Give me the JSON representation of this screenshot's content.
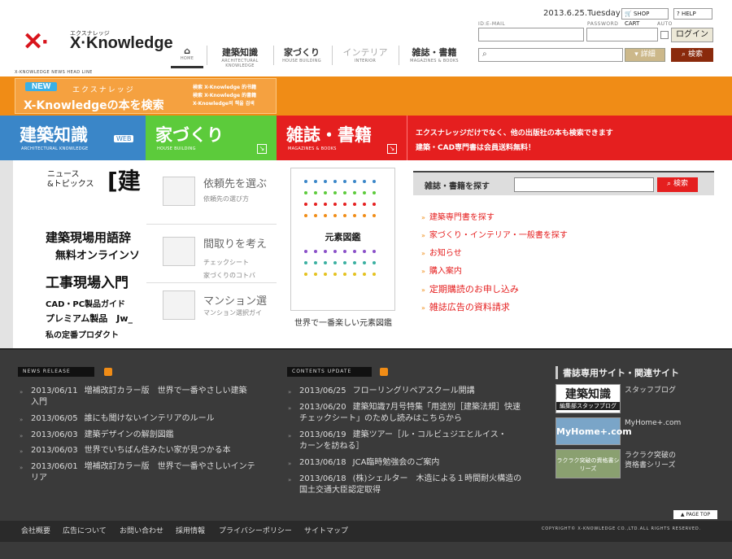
{
  "header": {
    "logo_text": "X·Knowledge",
    "logo_sub": "エクスナレッジ",
    "date": "2013.6.25.Tuesday",
    "shop_cart": "SHOP CART",
    "help": "HELP",
    "id_label": "ID:E-MAIL",
    "password_label": "PASSWORD",
    "auto_label": "AUTO",
    "login": "ログイン",
    "detail": "詳細",
    "search": "検索"
  },
  "nav": {
    "home": {
      "j": "⌂",
      "e": "HOME"
    },
    "items": [
      {
        "j": "建築知識",
        "e": "ARCHITECTURAL KNOWLEDGE"
      },
      {
        "j": "家づくり",
        "e": "HOUSE BUILDING"
      },
      {
        "j": "インテリア",
        "e": "INTERIOR"
      },
      {
        "j": "雑誌・書籍",
        "e": "MAGAZINES & BOOKS"
      }
    ]
  },
  "headline_label": "X-KNOWLEDGE NEWS HEAD LINE",
  "banner": {
    "new": "NEW",
    "kana": "エクスナレッジ",
    "main": "X-Knowledgeの本を検索",
    "side1": "検索 X-Knowledge 的书籍",
    "side2": "検索 X-Knowledge 的書籍",
    "side3": "X-Knowledge의 책을 검색"
  },
  "categories": {
    "arch": {
      "j": "建築知識",
      "e": "ARCHITECTURAL KNOWLEDGE",
      "web": "WEB"
    },
    "house": {
      "j": "家づくり",
      "e": "HOUSE BUILDING"
    },
    "mag": {
      "j": "雑誌・書籍",
      "e": "MAGAZINES & BOOKS"
    },
    "info1": "エクスナレッジだけでなく、他の出版社の本も検索できます",
    "info2": "建築・CAD専門書は会員送料無料！"
  },
  "left_panel": {
    "news": "ニュース\n&トピックス",
    "l1": "[建",
    "l2": "建築現場用語辞",
    "l3": "無料オンラインソ",
    "l4": "工事現場入門",
    "l5": "CAD・PC製品ガイド",
    "l6": "プレミアム製品　Jw_",
    "l7": "私の定番プロダクト"
  },
  "mid_panel": [
    {
      "t": "依頼先を選ぶ",
      "s": "依頼先の選び方"
    },
    {
      "t": "間取りを考え",
      "s": "チェックシート",
      "s2": "家づくりのコトバ"
    },
    {
      "t": "マンション選",
      "s": "マンション選択ガイ"
    }
  ],
  "book": {
    "title": "元素図鑑",
    "caption": "世界で一番楽しい元素図鑑"
  },
  "mag_search": {
    "label": "雑誌・書籍を探す",
    "button": "検索"
  },
  "mag_links": [
    "建築専門書を探す",
    "家づくり・インテリア・一般書を探す",
    "お知らせ",
    "購入案内",
    "定期購読のお申し込み",
    "雑誌広告の資料請求"
  ],
  "news_release": {
    "header": "NEWS RELEASE",
    "items": [
      {
        "d": "2013/06/11",
        "t": "増補改訂カラー版　世界で一番やさしい建築",
        "t2": "入門"
      },
      {
        "d": "2013/06/05",
        "t": "誰にも聞けないインテリアのルール"
      },
      {
        "d": "2013/06/03",
        "t": "建築デザインの解剖図鑑"
      },
      {
        "d": "2013/06/03",
        "t": "世界でいちばん住みたい家が見つかる本"
      },
      {
        "d": "2013/06/01",
        "t": "増補改訂カラー版　世界で一番やさしいインテ",
        "t2": "リア"
      }
    ]
  },
  "contents_update": {
    "header": "CONTENTS UPDATE",
    "items": [
      {
        "d": "2013/06/25",
        "t": "フローリングリペアスクール開講"
      },
      {
        "d": "2013/06/20",
        "t": "建築知識7月号特集「用途別［建築法規］快速",
        "t2": "チェックシート」のためし読みはこちらから"
      },
      {
        "d": "2013/06/19",
        "t": "建築ツアー［ル・コルビュジエとルイス・",
        "t2": "カーンを訪ねる］"
      },
      {
        "d": "2013/06/18",
        "t": "JCA臨時勉強会のご案内"
      },
      {
        "d": "2013/06/18",
        "t": "(株)シェルター　木造による１時間耐火構造の",
        "t2": "国土交通大臣認定取得"
      }
    ]
  },
  "related": {
    "title": "書誌専用サイト・関連サイト",
    "r1_img": "建築知識",
    "r1_sub": "編集部スタッフブログ",
    "r1_text": "スタッフブログ",
    "r2_img": "MyHome+.com",
    "r2_text": "MyHome+.com",
    "r3_img": "ラクラク突破の資格書シリーズ",
    "r3_text1": "ラクラク突破の",
    "r3_text2": "資格書シリーズ"
  },
  "footer": {
    "page_top": "PAGE TOP",
    "links": [
      "会社概要",
      "広告について",
      "お問い合わせ",
      "採用情報",
      "プライバシーポリシー",
      "サイトマップ"
    ],
    "copyright": "COPYRIGHT© X-KNOWLEDGE CO.,LTD.ALL RIGHTS RESERVED."
  }
}
